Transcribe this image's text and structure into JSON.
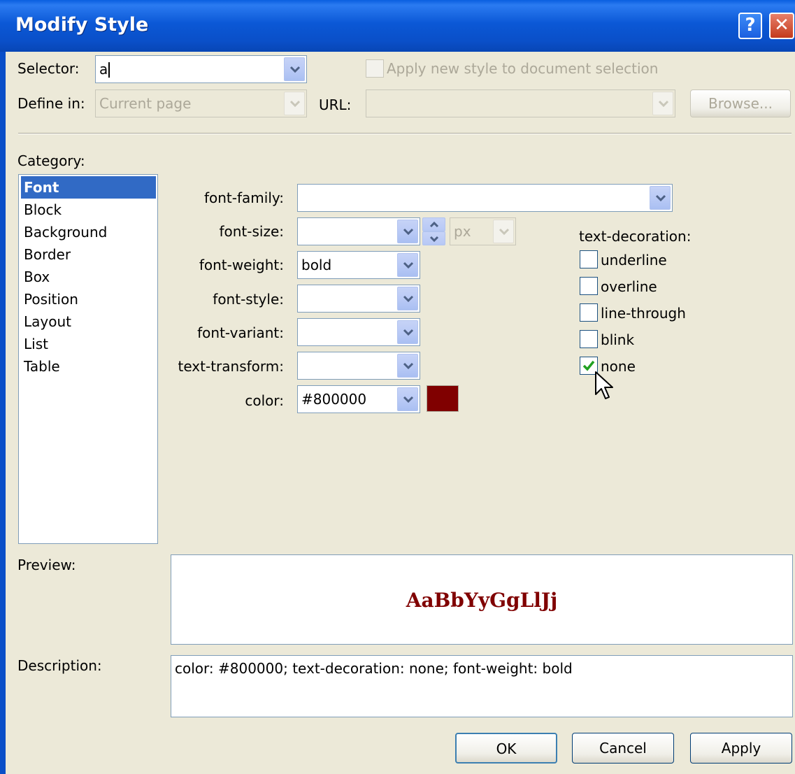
{
  "window": {
    "title": "Modify Style",
    "help_glyph": "?",
    "close_glyph": "✕"
  },
  "selector": {
    "label": "Selector:",
    "value": "a"
  },
  "apply_new_style_label": "Apply new style to document selection",
  "define_in": {
    "label": "Define in:",
    "value": "Current page"
  },
  "url": {
    "label": "URL:",
    "value": ""
  },
  "browse_label": "Browse...",
  "category": {
    "label": "Category:",
    "items": [
      {
        "label": "Font",
        "selected": true
      },
      {
        "label": "Block"
      },
      {
        "label": "Background"
      },
      {
        "label": "Border"
      },
      {
        "label": "Box"
      },
      {
        "label": "Position"
      },
      {
        "label": "Layout"
      },
      {
        "label": "List"
      },
      {
        "label": "Table"
      }
    ]
  },
  "font": {
    "family": {
      "label": "font-family:",
      "value": ""
    },
    "size": {
      "label": "font-size:",
      "value": "",
      "unit": "px"
    },
    "weight": {
      "label": "font-weight:",
      "value": "bold"
    },
    "style": {
      "label": "font-style:",
      "value": ""
    },
    "variant": {
      "label": "font-variant:",
      "value": ""
    },
    "transform": {
      "label": "text-transform:",
      "value": ""
    },
    "color": {
      "label": "color:",
      "value": "#800000",
      "swatch": "#800000"
    }
  },
  "text_decoration": {
    "label": "text-decoration:",
    "options": [
      {
        "label": "underline",
        "checked": false
      },
      {
        "label": "overline",
        "checked": false
      },
      {
        "label": "line-through",
        "checked": false
      },
      {
        "label": "blink",
        "checked": false
      },
      {
        "label": "none",
        "checked": true
      }
    ]
  },
  "preview": {
    "label": "Preview:",
    "sample": "AaBbYyGgLlJj"
  },
  "description": {
    "label": "Description:",
    "text": "color: #800000; text-decoration: none; font-weight: bold"
  },
  "buttons": {
    "ok": "OK",
    "cancel": "Cancel",
    "apply": "Apply"
  },
  "colors": {
    "title_bar": "#0a4fc8",
    "dialog_bg": "#ece9d8",
    "selection": "#316ac5",
    "swatch": "#800000"
  }
}
